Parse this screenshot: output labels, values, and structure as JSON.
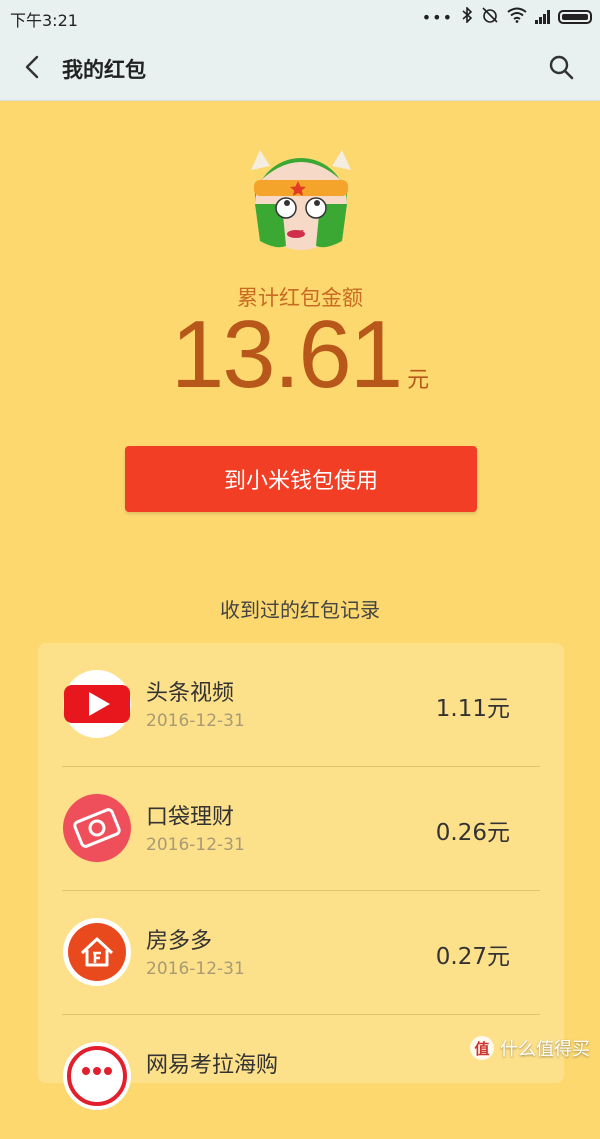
{
  "status_bar": {
    "time": "下午3:21",
    "icons": [
      "dots-icon",
      "bluetooth-icon",
      "alarm-off-icon",
      "wifi-icon",
      "signal-icon",
      "battery-icon"
    ]
  },
  "nav": {
    "title": "我的红包",
    "back_icon": "chevron-left-icon",
    "search_icon": "search-icon"
  },
  "summary": {
    "label": "累计红包金额",
    "amount": "13.61",
    "unit": "元"
  },
  "use_button": {
    "label": "到小米钱包使用",
    "color": "#f23e25"
  },
  "records": {
    "title": "收到过的红包记录",
    "items": [
      {
        "name": "头条视频",
        "date": "2016-12-31",
        "amount": "1.11元",
        "icon": "video-play-icon"
      },
      {
        "name": "口袋理财",
        "date": "2016-12-31",
        "amount": "0.26元",
        "icon": "wallet-card-icon"
      },
      {
        "name": "房多多",
        "date": "2016-12-31",
        "amount": "0.27元",
        "icon": "house-icon"
      },
      {
        "name": "网易考拉海购",
        "date": "",
        "amount": "",
        "icon": "koala-icon"
      }
    ]
  },
  "watermark": {
    "badge": "值",
    "text": "什么值得买"
  },
  "colors": {
    "background": "#fcd86f",
    "accent_text": "#b8571a",
    "button": "#f23e25"
  }
}
